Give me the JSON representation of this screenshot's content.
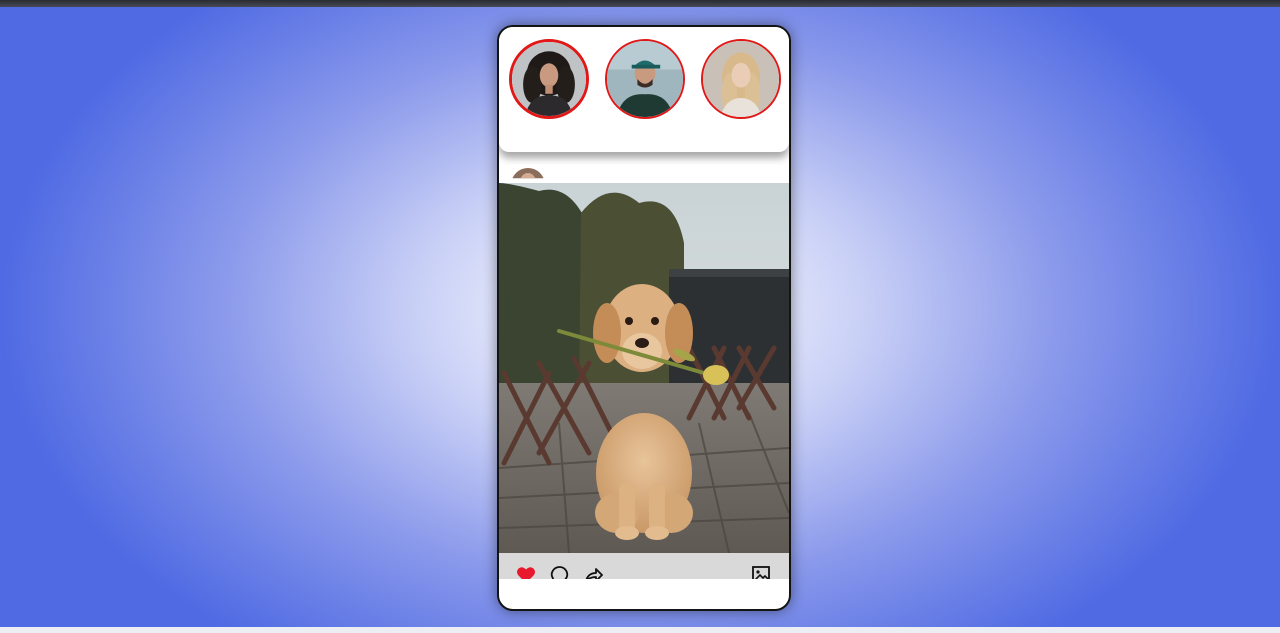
{
  "stories": [
    {
      "icon": "story-avatar-woman-curly-hair",
      "active": true
    },
    {
      "icon": "story-avatar-man-cap",
      "active": false
    },
    {
      "icon": "story-avatar-woman-blonde",
      "active": false
    }
  ],
  "post": {
    "image": "golden-retriever-puppy-holding-tulip",
    "liked": true
  },
  "actions": [
    {
      "icon": "heart-icon",
      "color": "#e8192c"
    },
    {
      "icon": "comment-icon",
      "color": "#111111"
    },
    {
      "icon": "share-icon",
      "color": "#111111"
    },
    {
      "icon": "save-image-icon",
      "color": "#111111"
    }
  ],
  "colors": {
    "story_ring": "#e01818",
    "background_edge": "#4f6ae3",
    "background_center": "#ffffff",
    "action_bar": "#d9d9d9"
  }
}
